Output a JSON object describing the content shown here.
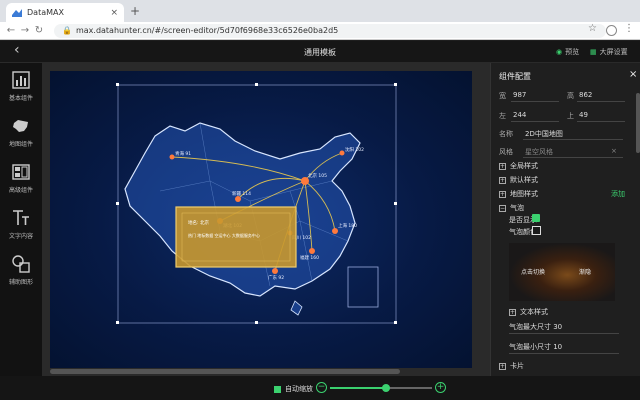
{
  "browser": {
    "tab_title": "DataMAX",
    "tab_close": "×",
    "new_tab": "+",
    "url": "max.datahunter.cn/#/screen-editor/5d70f6968e33c6526e0ba2d5"
  },
  "header": {
    "back": "‹",
    "title": "通用模板",
    "preview": "预览",
    "screen_settings": "大屏设置"
  },
  "sidebar": {
    "items": [
      {
        "label": "基本组件",
        "icon": "bar-chart-icon"
      },
      {
        "label": "地图组件",
        "icon": "map-icon"
      },
      {
        "label": "高级组件",
        "icon": "advanced-chart-icon"
      },
      {
        "label": "文字内容",
        "icon": "text-icon"
      },
      {
        "label": "辅助图形",
        "icon": "shapes-icon"
      }
    ]
  },
  "panel": {
    "title": "组件配置",
    "close": "×",
    "width_label": "宽",
    "width_value": "987",
    "height_label": "高",
    "height_value": "862",
    "left_label": "左",
    "left_value": "244",
    "top_label": "上",
    "top_value": "49",
    "name_label": "名称",
    "name_value": "2D中国地图",
    "style_label": "风格",
    "style_value": "星空风格",
    "style_clear": "×",
    "sections": {
      "global": "全局样式",
      "default": "默认样式",
      "map": "地图样式",
      "map_add": "添加",
      "bubble": "气泡",
      "show_label": "是否显示",
      "bubble_color": "气泡颜色",
      "bubble_label_left": "点击切换",
      "bubble_label_right": "渐隐",
      "text_style": "文本样式",
      "max_size": "气泡最大尺寸 30",
      "min_size": "气泡最小尺寸 10",
      "card": "卡片"
    }
  },
  "map": {
    "tooltip_title": "地名: 北京",
    "tooltip_line": "热门 地标数据 空运中心 大数据服务中心",
    "city_labels": [
      "北京 105",
      "沈阳 102",
      "青海 91",
      "新疆 114",
      "广东 92",
      "四川 102",
      "上海 180",
      "福建 160",
      "湖北 102"
    ]
  },
  "bottom": {
    "auto_zoom": "自动缩放",
    "minus": "−",
    "plus": "+",
    "zoom_level": 0.55
  },
  "colors": {
    "accent": "#3bd16f",
    "map_bg": "#071a45",
    "panel_bg": "#1f1f1f"
  }
}
